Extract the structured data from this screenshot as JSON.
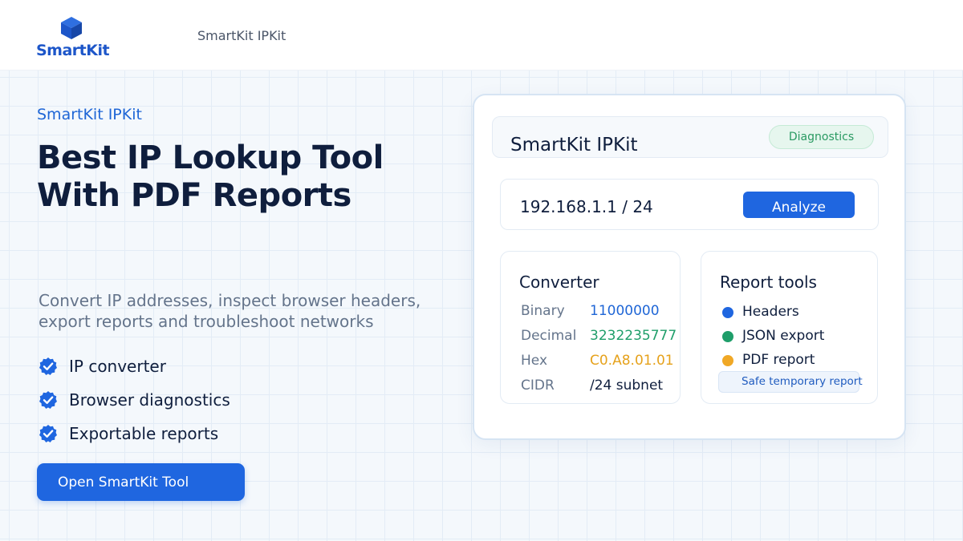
{
  "header": {
    "logo_text": "SmartKit",
    "title": "SmartKit IPKit"
  },
  "hero": {
    "eyebrow": "SmartKit IPKit",
    "headline_line1": "Best IP Lookup Tool",
    "headline_line2": "With PDF Reports",
    "description": "Convert IP addresses, inspect browser headers, export reports and troubleshoot networks",
    "features": [
      {
        "label": "IP converter",
        "icon": "check-circle-icon"
      },
      {
        "label": "Browser diagnostics",
        "icon": "check-circle-icon"
      },
      {
        "label": "Exportable reports",
        "icon": "check-circle-icon"
      }
    ],
    "cta_label": "Open SmartKit Tool"
  },
  "card": {
    "title": "SmartKit IPKit",
    "badge": "Diagnostics",
    "ip_value": "192.168.1.1 / 24",
    "analyze_label": "Analyze",
    "converter": {
      "title": "Converter",
      "rows": [
        {
          "key": "Binary",
          "value": "11000000",
          "color": "#1f66d6"
        },
        {
          "key": "Decimal",
          "value": "3232235777",
          "color": "#1f9e6a"
        },
        {
          "key": "Hex",
          "value": "C0.A8.01.01",
          "color": "#e6a21c"
        },
        {
          "key": "CIDR",
          "value": "/24 subnet",
          "color": "#0f1e3d"
        }
      ]
    },
    "report_tools": {
      "title": "Report tools",
      "items": [
        {
          "label": "Headers",
          "color": "#1f66e0"
        },
        {
          "label": "JSON export",
          "color": "#1f9e6a"
        },
        {
          "label": "PDF report",
          "color": "#f0a826"
        }
      ],
      "note": "Safe temporary report"
    }
  },
  "colors": {
    "accent": "#1f66e0",
    "brand": "#1d56c9",
    "success": "#2a9a62"
  }
}
